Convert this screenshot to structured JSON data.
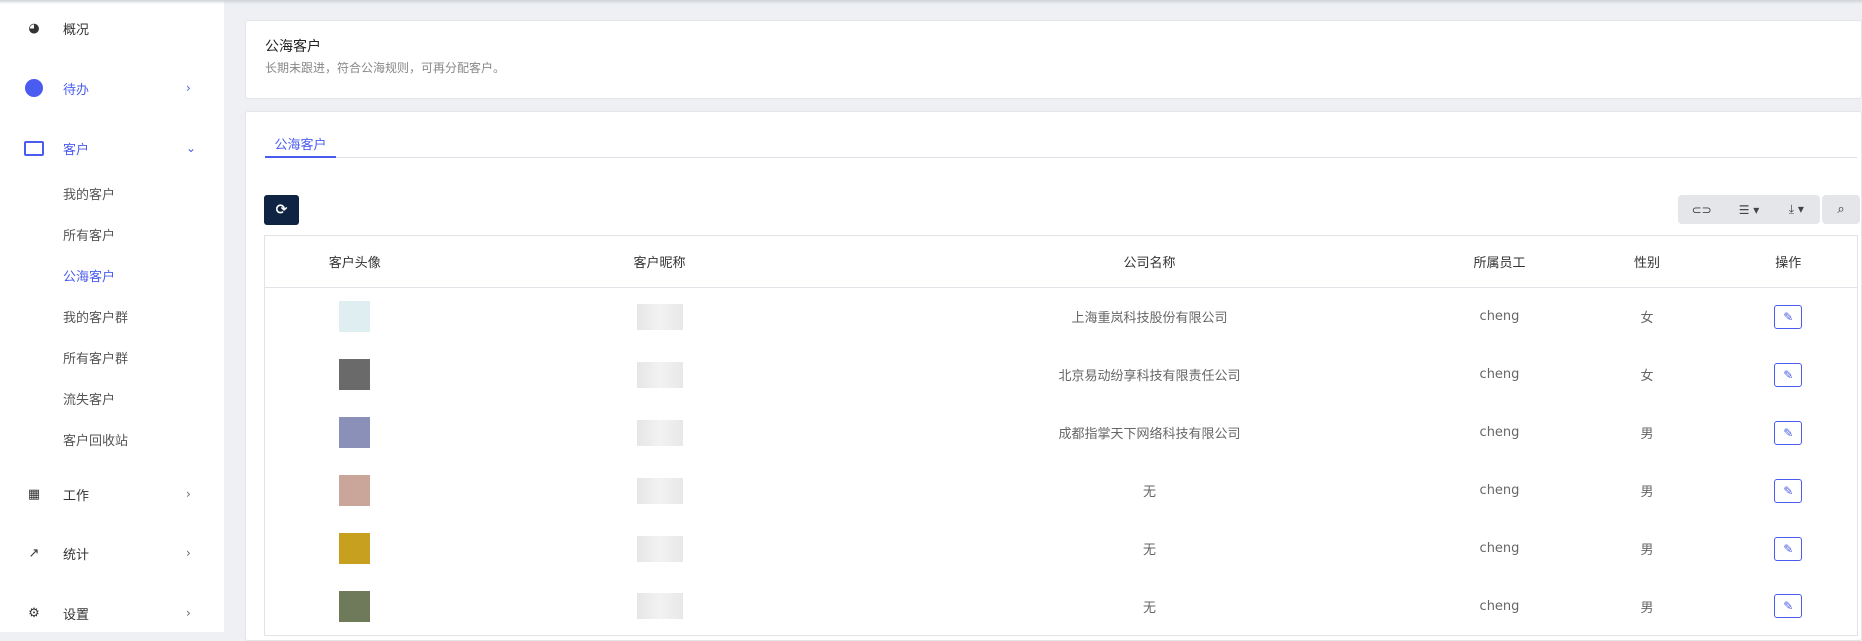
{
  "sidebar": {
    "items": [
      {
        "label": "概况",
        "icon": "dashboard-icon"
      },
      {
        "label": "待办",
        "icon": "todo-icon"
      },
      {
        "label": "客户",
        "icon": "id-card-icon"
      },
      {
        "label": "工作",
        "icon": "grid-icon"
      },
      {
        "label": "统计",
        "icon": "chart-line-icon"
      },
      {
        "label": "设置",
        "icon": "gear-icon"
      }
    ],
    "sub_items": [
      "我的客户",
      "所有客户",
      "公海客户",
      "我的客户群",
      "所有客户群",
      "流失客户",
      "客户回收站"
    ]
  },
  "header": {
    "title": "公海客户",
    "desc": "长期未跟进，符合公海规则，可再分配客户。"
  },
  "tabs": [
    "公海客户"
  ],
  "table": {
    "columns": [
      "客户头像",
      "客户昵称",
      "公司名称",
      "所属员工",
      "性别",
      "操作"
    ],
    "rows": [
      {
        "company": "上海重岚科技股份有限公司",
        "staff": "cheng",
        "gender": "女",
        "avatar_color": "#dfeef0"
      },
      {
        "company": "北京易动纷享科技有限责任公司",
        "staff": "cheng",
        "gender": "女",
        "avatar_color": "#6a6a6a"
      },
      {
        "company": "成都指掌天下网络科技有限公司",
        "staff": "cheng",
        "gender": "男",
        "avatar_color": "#8a90b8"
      },
      {
        "company": "无",
        "staff": "cheng",
        "gender": "男",
        "avatar_color": "#c9a59a"
      },
      {
        "company": "无",
        "staff": "cheng",
        "gender": "男",
        "avatar_color": "#c8a020"
      },
      {
        "company": "无",
        "staff": "cheng",
        "gender": "男",
        "avatar_color": "#6e7a5a"
      }
    ]
  }
}
